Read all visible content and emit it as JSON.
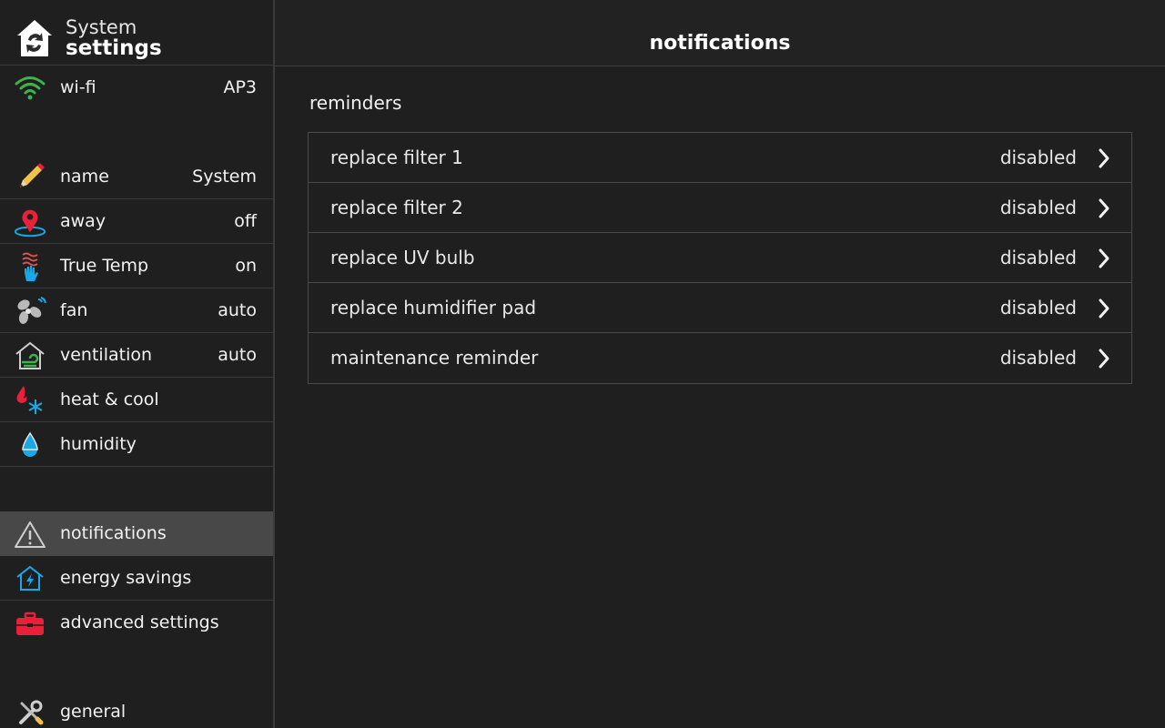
{
  "brand": {
    "line1": "System",
    "line2": "settings",
    "logo_icon": "house-sync-icon"
  },
  "sidebar": {
    "items": [
      {
        "key": "wifi",
        "label": "wi-fi",
        "value": "AP3",
        "icon": "wifi-icon",
        "icon_color": "#3db34a"
      },
      {
        "key": "name",
        "label": "name",
        "value": "System",
        "icon": "pencil-icon",
        "icon_color": "#f0c24b"
      },
      {
        "key": "away",
        "label": "away",
        "value": "off",
        "icon": "location-pin-icon",
        "icon_color": "#e8203a"
      },
      {
        "key": "truetemp",
        "label": "True Temp",
        "value": "on",
        "icon": "hand-heat-icon",
        "icon_color": "#d9534f"
      },
      {
        "key": "fan",
        "label": "fan",
        "value": "auto",
        "icon": "fan-icon",
        "icon_color": "#b9b9b9"
      },
      {
        "key": "ventilation",
        "label": "ventilation",
        "value": "auto",
        "icon": "ventilation-house-icon",
        "icon_color": "#3db34a"
      },
      {
        "key": "heatcool",
        "label": "heat & cool",
        "value": "",
        "icon": "flame-snowflake-icon",
        "icon_color": "#e8203a"
      },
      {
        "key": "humidity",
        "label": "humidity",
        "value": "",
        "icon": "water-drop-icon",
        "icon_color": "#19a9e6"
      },
      {
        "key": "notifications",
        "label": "notifications",
        "value": "",
        "icon": "warning-triangle-icon",
        "icon_color": "#cfcfcf",
        "active": true
      },
      {
        "key": "energy",
        "label": "energy savings",
        "value": "",
        "icon": "house-bolt-icon",
        "icon_color": "#19a9e6"
      },
      {
        "key": "advanced",
        "label": "advanced settings",
        "value": "",
        "icon": "toolbox-icon",
        "icon_color": "#e8203a"
      },
      {
        "key": "general",
        "label": "general",
        "value": "",
        "icon": "tools-icon",
        "icon_color": "#cfcfcf"
      }
    ]
  },
  "main": {
    "title": "notifications",
    "section_title": "reminders",
    "reminders": [
      {
        "label": "replace filter 1",
        "status": "disabled"
      },
      {
        "label": "replace filter 2",
        "status": "disabled"
      },
      {
        "label": "replace UV bulb",
        "status": "disabled"
      },
      {
        "label": "replace humidifier pad",
        "status": "disabled"
      },
      {
        "label": "maintenance reminder",
        "status": "disabled"
      }
    ]
  },
  "colors": {
    "background": "#1f1f1f",
    "active_item": "#484848",
    "divider": "#3a3a3a",
    "text": "#f2f2f2"
  }
}
